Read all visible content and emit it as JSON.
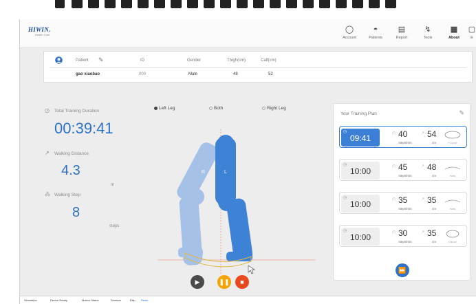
{
  "header": {
    "logo": "HIWIN.",
    "logo_sub": "Health Care",
    "nav": [
      {
        "label": "Account",
        "icon": "account-icon"
      },
      {
        "label": "Patients",
        "icon": "patients-icon"
      },
      {
        "label": "Report",
        "icon": "report-icon"
      },
      {
        "label": "Tools",
        "icon": "tools-icon"
      },
      {
        "label": "About",
        "icon": "about-icon"
      },
      {
        "label": "E",
        "icon": "exit-icon"
      }
    ]
  },
  "patient": {
    "headers": {
      "patient": "Patient",
      "id": "ID",
      "gender": "Gender",
      "thigh": "Thigh(cm)",
      "calf": "Calf(cm)"
    },
    "values": {
      "name": "gao xiaobao",
      "id": "000",
      "gender": "Male",
      "thigh": "48",
      "calf": "52"
    }
  },
  "stats": {
    "duration_label": "Total Training Duration",
    "duration": "00:39:41",
    "distance_label": "Walking Distance",
    "distance": "4.3",
    "distance_unit": "m",
    "step_label": "Walking Step",
    "steps": "8",
    "step_unit": "steps"
  },
  "legs": {
    "left": "Left Leg",
    "both": "Both",
    "right": "Right Leg",
    "selected": "left",
    "label_r": "R",
    "label_l": "L"
  },
  "plan": {
    "title": "Your Training Plan",
    "rows": [
      {
        "time": "09:41",
        "speed": "40",
        "speed_unit": "steps/min",
        "stride": "54",
        "stride_unit": "cm",
        "shape": "FClipse",
        "active": true
      },
      {
        "time": "10:00",
        "speed": "45",
        "speed_unit": "steps/min",
        "stride": "48",
        "stride_unit": "cm",
        "shape": "Walk",
        "active": false
      },
      {
        "time": "10:00",
        "speed": "35",
        "speed_unit": "steps/min",
        "stride": "35",
        "stride_unit": "cm",
        "shape": "Walk",
        "active": false
      },
      {
        "time": "10:00",
        "speed": "30",
        "speed_unit": "steps/min",
        "stride": "35",
        "stride_unit": "cm",
        "shape": "Ellipse",
        "active": false
      }
    ]
  },
  "footer": {
    "items": [
      "Simulation",
      "Device Ready",
      "Motion Status",
      "Seminar",
      "Ellip",
      "Reset"
    ]
  }
}
